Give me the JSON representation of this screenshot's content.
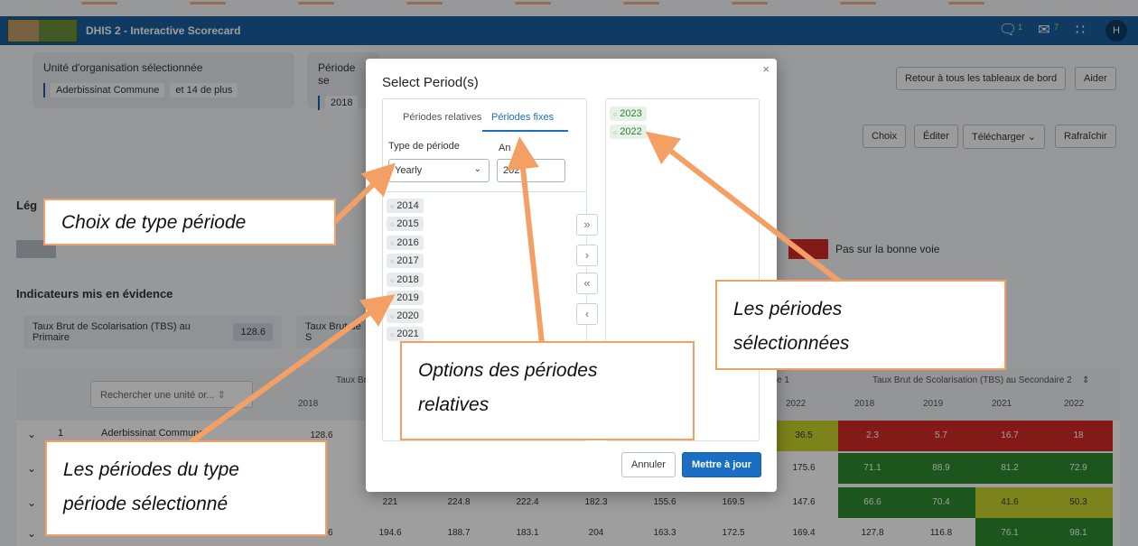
{
  "topbar": {
    "title": "DHIS 2 - Interactive Scorecard",
    "notifications": [
      {
        "icon": "chat-icon",
        "count": "1"
      },
      {
        "icon": "mail-icon",
        "count": "7"
      },
      {
        "icon": "apps-grid-icon",
        "count": ""
      }
    ],
    "user_initial": "H"
  },
  "org_unit": {
    "label": "Unité d'organisation sélectionnée",
    "chips": [
      "Aderbissinat Commune",
      "et 14 de plus"
    ]
  },
  "period_card": {
    "label": "Période se",
    "value": "2018"
  },
  "header_buttons": {
    "back": "Retour à tous les tableaux de bord",
    "help": "Aider"
  },
  "toolbar": {
    "choice": "Choix",
    "edit": "Éditer",
    "download": "Télécharger",
    "refresh": "Rafraîchir"
  },
  "legend": {
    "title": "Lég",
    "off_track": "Pas sur la bonne voie",
    "colors": {
      "red": "#d62b27",
      "green": "#2e8b2e",
      "yellow": "#c9d32b",
      "grey": "#b7bec6"
    }
  },
  "highlights": {
    "title": "Indicateurs mis en évidence",
    "items": [
      {
        "label": "Taux Brut de Scolarisation (TBS) au Primaire",
        "value": "128.6"
      },
      {
        "label": "Taux Brut de S",
        "value": ""
      }
    ]
  },
  "table": {
    "search_placeholder": "Rechercher une unité or...",
    "group_headers": [
      "Taux Brut d",
      "e 1",
      "Taux Brut de Scolarisation (TBS) au Secondaire 2"
    ],
    "year_headers_left": [
      "2018"
    ],
    "year_headers_right": [
      "2022",
      "2018",
      "2019",
      "2021",
      "2022"
    ],
    "rows": [
      {
        "index": "1",
        "name": "Aderbissinat Commune",
        "first": "128.6",
        "mid": [
          "",
          "",
          "",
          "",
          "",
          ""
        ],
        "right": [
          "36.5",
          "2.3",
          "5.7",
          "16.7",
          "18"
        ]
      },
      {
        "index": "",
        "name": "",
        "first": "",
        "mid": [
          "",
          "",
          "",
          "",
          "",
          ""
        ],
        "right": [
          "175.6",
          "71.1",
          "88.9",
          "81.2",
          "72.9"
        ]
      },
      {
        "index": "",
        "name": "",
        "first": "",
        "mid": [
          "221",
          "224.8",
          "222.4",
          "182.3",
          "155.6",
          "169.5"
        ],
        "right": [
          "147.6",
          "66.6",
          "70.4",
          "41.6",
          "50.3"
        ]
      },
      {
        "index": "",
        "name": "",
        "first": "197.6",
        "mid": [
          "194.6",
          "188.7",
          "183.1",
          "204",
          "163.3",
          "172.5"
        ],
        "right": [
          "169.4",
          "127.8",
          "116.8",
          "76.1",
          "98.1"
        ]
      }
    ]
  },
  "modal": {
    "title": "Select Period(s)",
    "tabs": [
      "Périodes relatives",
      "Périodes fixes"
    ],
    "period_type_label": "Type de période",
    "period_type_value": "Yearly",
    "year_label": "An",
    "year_value": "202",
    "available_periods": [
      "2014",
      "2015",
      "2016",
      "2017",
      "2018",
      "2019",
      "2020",
      "2021"
    ],
    "selected_periods": [
      "2023",
      "2022"
    ],
    "move_buttons": [
      "»",
      "›",
      "«",
      "‹"
    ],
    "cancel": "Annuler",
    "update": "Mettre à jour"
  },
  "annotations": {
    "period_type": "Choix de type période",
    "relative_options": [
      "Options des périodes",
      "relatives"
    ],
    "selected": [
      "Les périodes",
      "sélectionnées"
    ],
    "type_periods": [
      "Les périodes du type",
      "période sélectionné"
    ],
    "color": "#f4a064"
  }
}
